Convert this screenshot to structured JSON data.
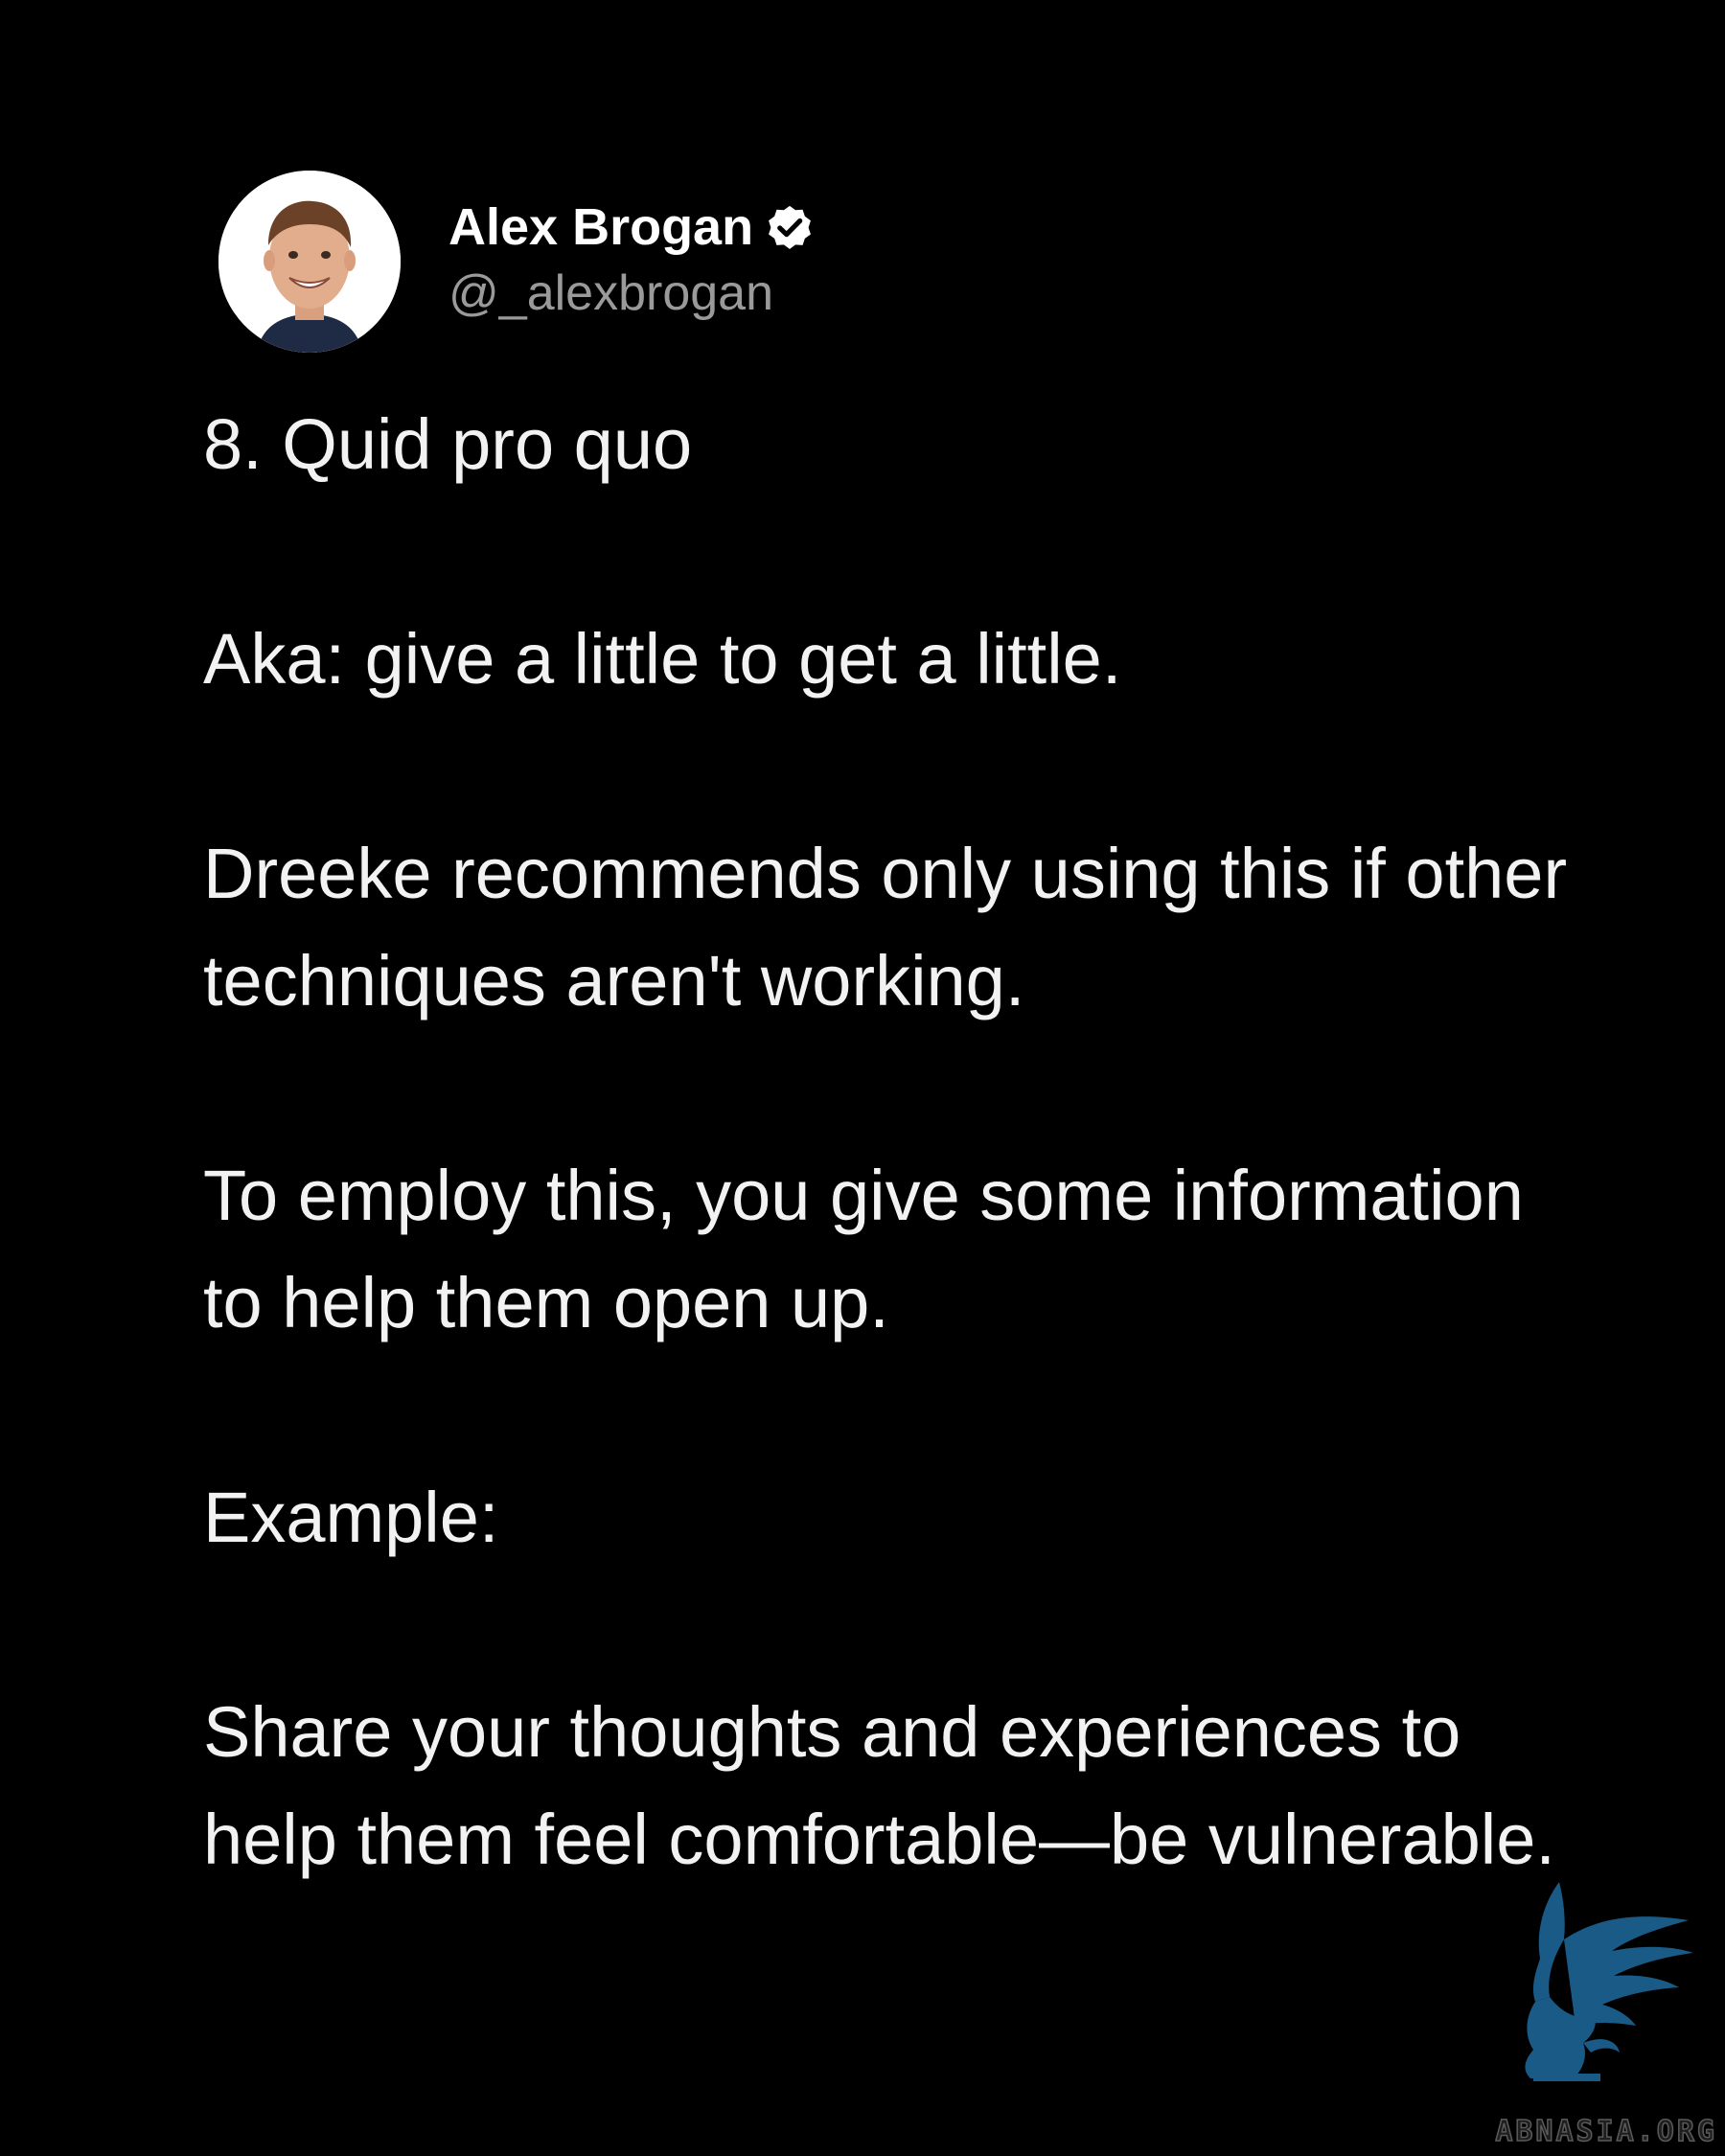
{
  "author": {
    "name": "Alex Brogan",
    "handle": "@_alexbrogan",
    "verified_icon": "verified-badge-icon",
    "avatar_icon": "profile-photo"
  },
  "post": {
    "paragraphs": [
      "8. Quid pro quo",
      "Aka: give a little to get a little.",
      "Dreeke recommends only using this if other techniques aren't working.",
      "To employ this, you give some information to help them open up.",
      "Example:",
      "Share your thoughts and experiences to help them feel comfortable—be vulnerable."
    ]
  },
  "watermark": {
    "text": "ABNASIA.ORG",
    "logo_icon": "griffin-logo",
    "color": "#1a5a86"
  },
  "colors": {
    "background": "#000000",
    "text": "#ffffff",
    "handle": "#9a9a9a"
  }
}
